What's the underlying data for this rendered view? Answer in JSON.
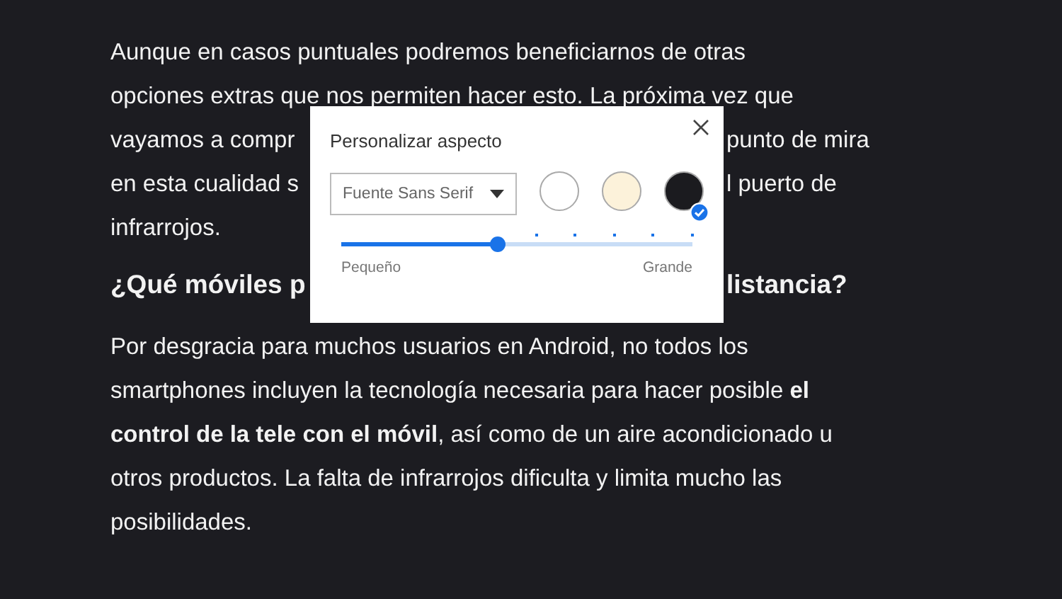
{
  "article": {
    "paragraph_1": [
      {
        "kind": "full",
        "text": "Aunque en casos puntuales podremos beneficiarnos de otras"
      },
      {
        "kind": "full",
        "text": "opciones extras que nos permiten hacer esto. La próxima vez que"
      },
      {
        "kind": "split",
        "left": "vayamos a compr",
        "right": "punto de mira"
      },
      {
        "kind": "split",
        "left": "en esta cualidad s",
        "right": "l puerto de"
      },
      {
        "kind": "full",
        "text": "infrarrojos."
      }
    ],
    "heading": {
      "kind": "split",
      "left": "¿Qué móviles p",
      "right": "listancia?"
    },
    "paragraph_2": [
      {
        "kind": "full",
        "text": "Por desgracia para muchos usuarios en Android, no todos los"
      },
      {
        "kind": "full",
        "text": "smartphones incluyen la tecnología necesaria para hacer posible **el**"
      },
      {
        "kind": "full",
        "text": "**control de la tele con el móvil**, así como de un aire acondicionado u"
      },
      {
        "kind": "full",
        "text": "otros productos. La falta de infrarrojos dificulta y limita mucho las"
      },
      {
        "kind": "full",
        "text": "posibilidades."
      }
    ]
  },
  "dialog": {
    "title": "Personalizar aspecto",
    "font_select": {
      "value": "Fuente Sans Serif"
    },
    "themes": [
      {
        "color": "#ffffff",
        "selected": false
      },
      {
        "color": "#fcf2da",
        "selected": false
      },
      {
        "color": "#1b1b1f",
        "selected": true
      }
    ],
    "size_slider": {
      "level": 0.444,
      "min_label": "Pequeño",
      "max_label": "Grande"
    }
  }
}
